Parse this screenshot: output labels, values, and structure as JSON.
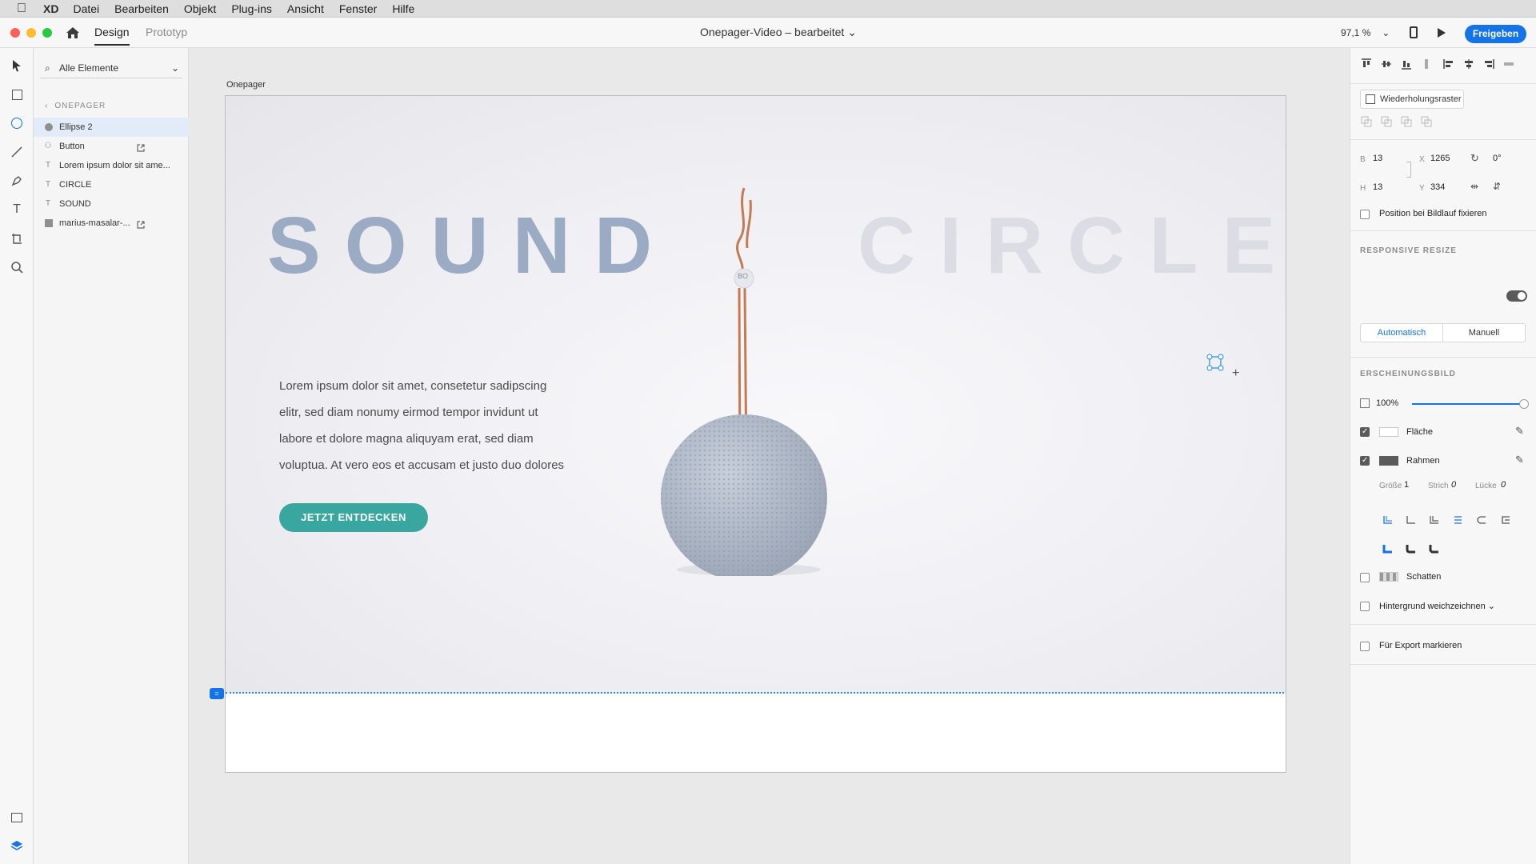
{
  "menubar": {
    "app": "XD",
    "items": [
      "Datei",
      "Bearbeiten",
      "Objekt",
      "Plug-ins",
      "Ansicht",
      "Fenster",
      "Hilfe"
    ]
  },
  "titlebar": {
    "tabs": [
      "Design",
      "Prototyp"
    ],
    "document_title": "Onepager-Video – bearbeitet",
    "zoom": "97,1 %",
    "share_label": "Freigeben"
  },
  "layers": {
    "filter_label": "Alle Elemente",
    "group": "ONEPAGER",
    "items": [
      {
        "label": "Ellipse 2",
        "icon": "ellipse-icon"
      },
      {
        "label": "Button",
        "icon": "component-icon"
      },
      {
        "label": "Lorem ipsum dolor sit ame...",
        "icon": "text-icon"
      },
      {
        "label": "CIRCLE",
        "icon": "text-icon"
      },
      {
        "label": "SOUND",
        "icon": "text-icon"
      },
      {
        "label": "marius-masalar-...",
        "icon": "image-icon"
      }
    ]
  },
  "canvas": {
    "artboard_name": "Onepager",
    "headline_left": "SOUND",
    "headline_right": "CIRCLE",
    "body_lines": [
      "Lorem ipsum dolor sit amet, consetetur sadipscing",
      "elitr, sed diam nonumy eirmod tempor invidunt ut",
      "labore et dolore magna aliquyam erat, sed diam",
      "voluptua. At vero eos et accusam et justo duo dolores"
    ],
    "cta_label": "JETZT ENTDECKEN",
    "logo_text": "BO"
  },
  "properties": {
    "repeat_grid": "Wiederholungsraster",
    "w_label": "B",
    "w_value": "13",
    "h_label": "H",
    "h_value": "13",
    "x_label": "X",
    "x_value": "1265",
    "y_label": "Y",
    "y_value": "334",
    "rotation": "0°",
    "fix_position": "Position bei Bildlauf fixieren",
    "responsive_resize": "RESPONSIVE RESIZE",
    "resize_auto": "Automatisch",
    "resize_manual": "Manuell",
    "appearance": "ERSCHEINUNGSBILD",
    "opacity": "100%",
    "opacity_level": 1.0,
    "fill_label": "Fläche",
    "border_label": "Rahmen",
    "size_label": "Größe",
    "size_value": "1",
    "dash_label": "Strich",
    "dash_value": "0",
    "gap_label": "Lücke",
    "gap_value": "0",
    "shadow_label": "Schatten",
    "bg_blur_label": "Hintergrund weichzeichnen",
    "export_label": "Für Export markieren"
  },
  "colors": {
    "accent": "#1473e6",
    "cta": "#3aa6a0",
    "sound_text": "#9aabc3",
    "circle_text": "#dcdde4"
  }
}
